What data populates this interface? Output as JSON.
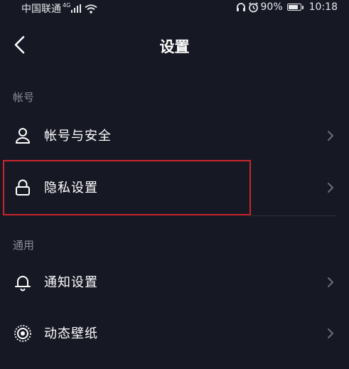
{
  "status_bar": {
    "carrier": "中国联通",
    "network": "4G",
    "battery_percent": "90%",
    "battery_level": 0.9,
    "time": "10:18",
    "icons": [
      "signal-icon",
      "wifi-icon",
      "headphone-icon",
      "alarm-icon",
      "battery-icon"
    ]
  },
  "header": {
    "title": "设置",
    "back_icon": "chevron-left-icon"
  },
  "sections": [
    {
      "label": "帐号",
      "items": [
        {
          "label": "帐号与安全",
          "icon": "user-icon"
        },
        {
          "label": "隐私设置",
          "icon": "lock-icon",
          "highlighted": true
        }
      ]
    },
    {
      "label": "通用",
      "items": [
        {
          "label": "通知设置",
          "icon": "bell-icon"
        },
        {
          "label": "动态壁纸",
          "icon": "wallpaper-icon"
        }
      ]
    }
  ],
  "colors": {
    "background": "#161824",
    "text": "#ffffff",
    "section_label": "#8a8c97",
    "chevron": "#6b6e7a",
    "highlight_border": "#c8262b"
  }
}
